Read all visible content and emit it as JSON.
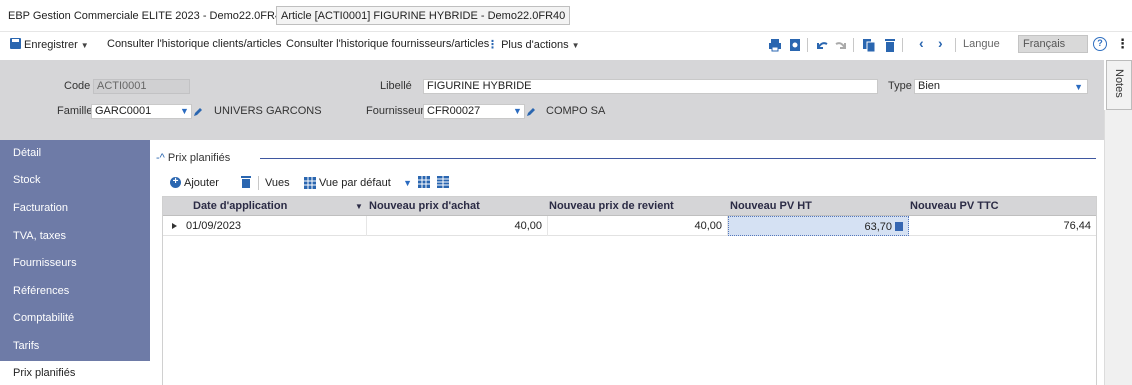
{
  "window": {
    "app_title": "EBP Gestion Commerciale ELITE 2023 - Demo22.0FR40",
    "doc_tab": "Article [ACTI0001] FIGURINE HYBRIDE - Demo22.0FR40"
  },
  "toolbar": {
    "save_label": "Enregistrer",
    "history_clients": "Consulter l'historique clients/articles",
    "history_suppliers": "Consulter l'historique fournisseurs/articles",
    "more_actions": "Plus d'actions",
    "language_label": "Langue",
    "language_value": "Français",
    "icons": [
      "print-icon",
      "preview-icon",
      "undo-icon",
      "redo-icon",
      "copy-icon",
      "delete-icon",
      "prev-icon",
      "next-icon",
      "help-icon",
      "more-icon"
    ]
  },
  "form": {
    "code_label": "Code",
    "code_value": "ACTI0001",
    "libelle_label": "Libellé",
    "libelle_value": "FIGURINE HYBRIDE",
    "type_label": "Type",
    "type_value": "Bien",
    "famille_label": "Famille",
    "famille_value": "GARC0001",
    "famille_name": "UNIVERS GARCONS",
    "fournisseur_label": "Fournisseur",
    "fournisseur_value": "CFR00027",
    "fournisseur_name": "COMPO SA"
  },
  "notes_tab": "Notes",
  "sidebar": {
    "items": [
      {
        "label": "Détail"
      },
      {
        "label": "Stock"
      },
      {
        "label": "Facturation"
      },
      {
        "label": "TVA, taxes"
      },
      {
        "label": "Fournisseurs"
      },
      {
        "label": "Références"
      },
      {
        "label": "Comptabilité"
      },
      {
        "label": "Tarifs"
      },
      {
        "label": "Prix planifiés"
      }
    ],
    "active": "Prix planifiés"
  },
  "section": {
    "title": "Prix planifiés",
    "add_label": "Ajouter",
    "views_label": "Vues",
    "view_value": "Vue par défaut"
  },
  "grid": {
    "columns": [
      "Date d'application",
      "Nouveau prix d'achat",
      "Nouveau prix de revient",
      "Nouveau PV HT",
      "Nouveau PV TTC"
    ],
    "rows": [
      {
        "date": "01/09/2023",
        "prix_achat": "40,00",
        "prix_revient": "40,00",
        "pv_ht": "63,70",
        "pv_ttc": "76,44"
      }
    ]
  },
  "colors": {
    "sidebar_bg": "#6e7ba7",
    "header_panel_bg": "#d6d6d8",
    "accent_blue": "#2a66b0",
    "selected_cell": "#d5e1f3"
  }
}
